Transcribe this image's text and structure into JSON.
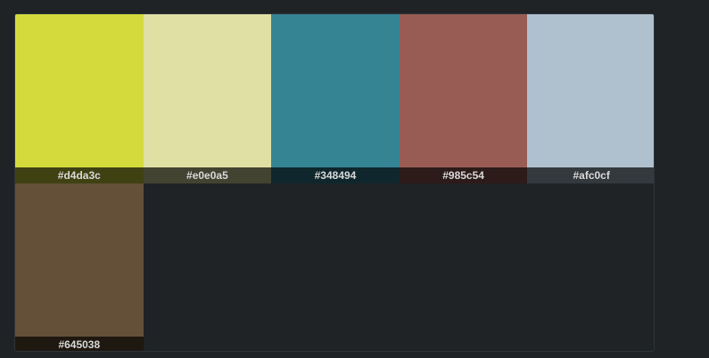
{
  "swatches": [
    {
      "hex": "#d4da3c",
      "label": "#d4da3c"
    },
    {
      "hex": "#e0e0a5",
      "label": "#e0e0a5"
    },
    {
      "hex": "#348494",
      "label": "#348494"
    },
    {
      "hex": "#985c54",
      "label": "#985c54"
    },
    {
      "hex": "#afc0cf",
      "label": "#afc0cf"
    },
    {
      "hex": "#645038",
      "label": "#645038"
    }
  ],
  "theme": {
    "background": "#1f2326",
    "label_text": "#d9d9d9"
  }
}
